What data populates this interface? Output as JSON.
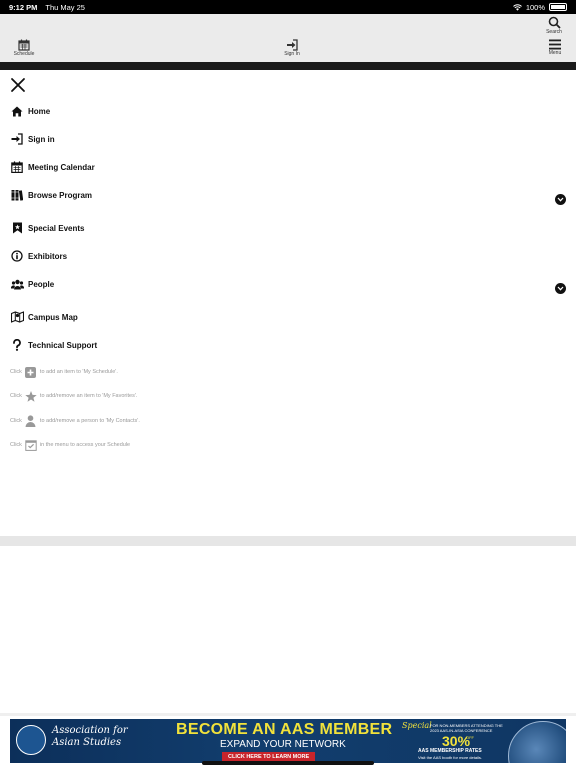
{
  "status_bar": {
    "time": "9:12 PM",
    "date": "Thu May 25",
    "battery": "100%"
  },
  "topbar": {
    "schedule_label": "Schedule",
    "signin_label": "Sign In",
    "search_label": "Search",
    "menu_label": "Menu"
  },
  "menu": {
    "items": [
      {
        "label": "Home",
        "icon": "home-icon"
      },
      {
        "label": "Sign in",
        "icon": "sign-in-icon"
      },
      {
        "label": "Meeting Calendar",
        "icon": "calendar-icon"
      },
      {
        "label": "Browse Program",
        "icon": "books-icon",
        "expandable": true
      },
      {
        "label": "Special Events",
        "icon": "bookmark-icon"
      },
      {
        "label": "Exhibitors",
        "icon": "info-icon"
      },
      {
        "label": "People",
        "icon": "people-icon",
        "expandable": true
      },
      {
        "label": "Campus Map",
        "icon": "map-icon"
      },
      {
        "label": "Technical Support",
        "icon": "question-icon"
      }
    ]
  },
  "help": {
    "add_schedule": {
      "before": "Click",
      "after": "to add an item to 'My Schedule'."
    },
    "favorites": {
      "before": "Click",
      "after": "to add/remove an item to 'My Favorites'."
    },
    "contacts": {
      "before": "Click",
      "after": "to add/remove a person to 'My Contacts'."
    },
    "access_schedule": {
      "before": "Click",
      "after": "in the menu to access your Schedule"
    }
  },
  "banner": {
    "org_line1": "Association for",
    "org_line2": "Asian Studies",
    "headline": "BECOME AN AAS MEMBER",
    "subheadline": "EXPAND YOUR NETWORK",
    "cta": "CLICK HERE TO LEARN MORE",
    "special": "Special",
    "offer_line1": "FOR NON-MEMBERS ATTENDING THE",
    "offer_line2": "2023 AAS-IN-ASIA CONFERENCE",
    "percent": "30%",
    "off": "OFF",
    "rates": "AAS MEMBERSHIP RATES",
    "details": "Visit the AAS booth for more details."
  },
  "colors": {
    "banner_bg": "#0f3663",
    "banner_accent": "#f2e23b",
    "cta": "#c8242b"
  }
}
